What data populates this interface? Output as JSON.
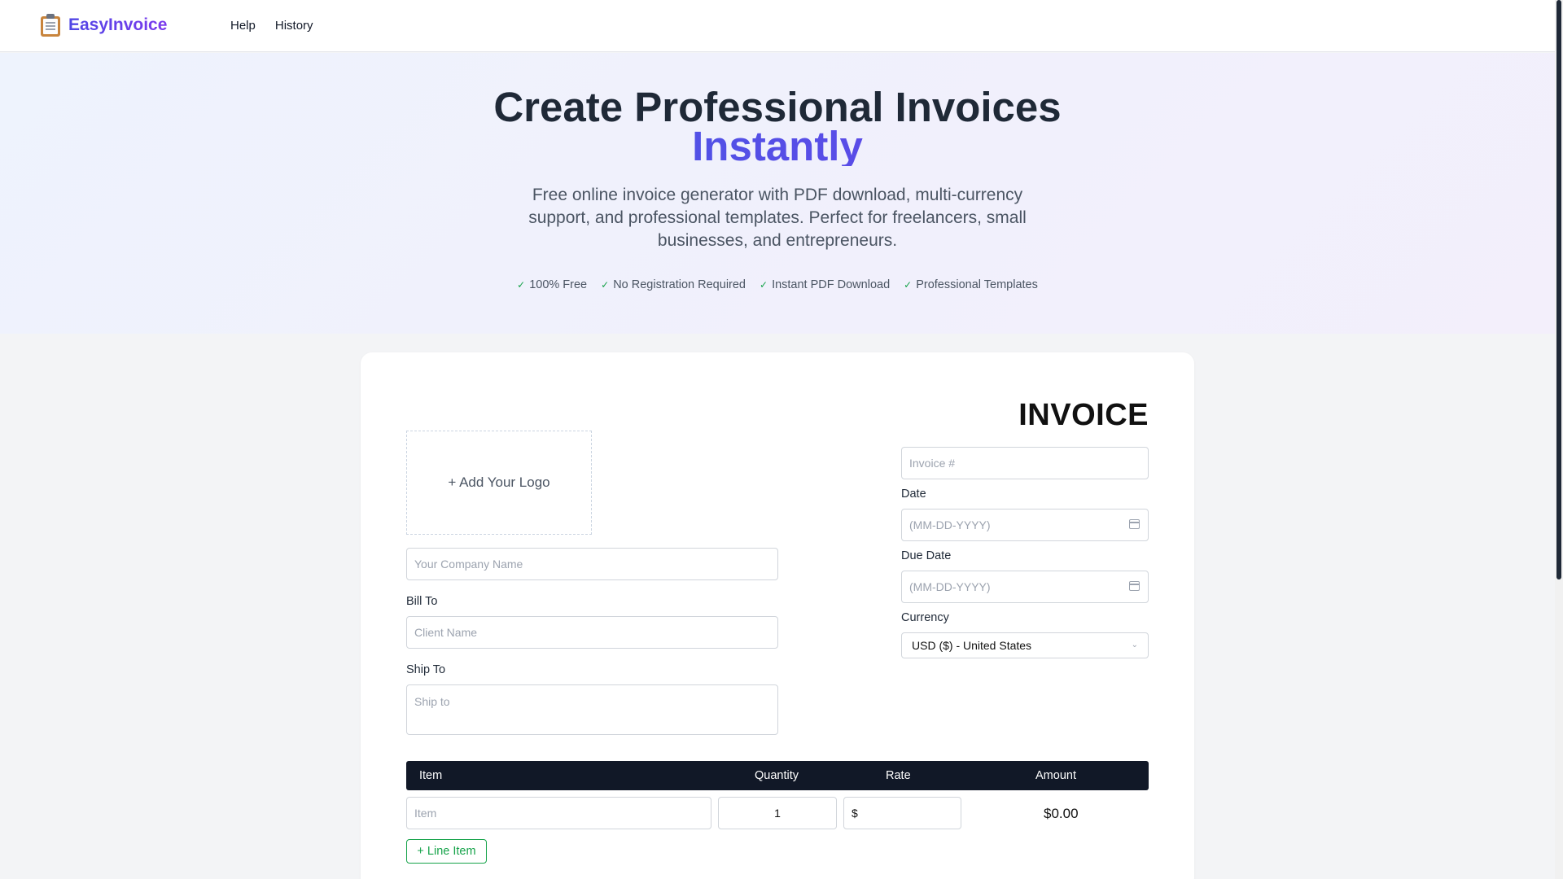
{
  "brand": {
    "name": "EasyInvoice",
    "icon": "clipboard-icon"
  },
  "nav": {
    "help": "Help",
    "history": "History"
  },
  "hero": {
    "title": "Create Professional Invoices",
    "title_accent": "Instantly",
    "subtitle": "Free online invoice generator with PDF download, multi-currency support, and professional templates. Perfect for freelancers, small businesses, and entrepreneurs.",
    "features": [
      "100% Free",
      "No Registration Required",
      "Instant PDF Download",
      "Professional Templates"
    ]
  },
  "invoice": {
    "title": "INVOICE",
    "logo_label": "+ Add Your Logo",
    "company_placeholder": "Your Company Name",
    "bill_to_label": "Bill To",
    "client_placeholder": "Client Name",
    "ship_to_label": "Ship To",
    "ship_to_placeholder": "Ship to",
    "invoice_number_placeholder": "Invoice #",
    "date_label": "Date",
    "date_placeholder": "(MM-DD-YYYY)",
    "due_date_label": "Due Date",
    "due_date_placeholder": "(MM-DD-YYYY)",
    "currency_label": "Currency",
    "currency_value": "USD ($) - United States"
  },
  "table": {
    "headers": {
      "item": "Item",
      "quantity": "Quantity",
      "rate": "Rate",
      "amount": "Amount"
    },
    "row": {
      "item_placeholder": "Item",
      "quantity": "1",
      "rate_prefix": "$",
      "amount": "$0.00"
    },
    "add_line_label": "+ Line Item"
  },
  "colors": {
    "accent_start": "#2f63e0",
    "accent_end": "#7c3aed",
    "table_header": "#111827",
    "success": "#16a34a"
  }
}
